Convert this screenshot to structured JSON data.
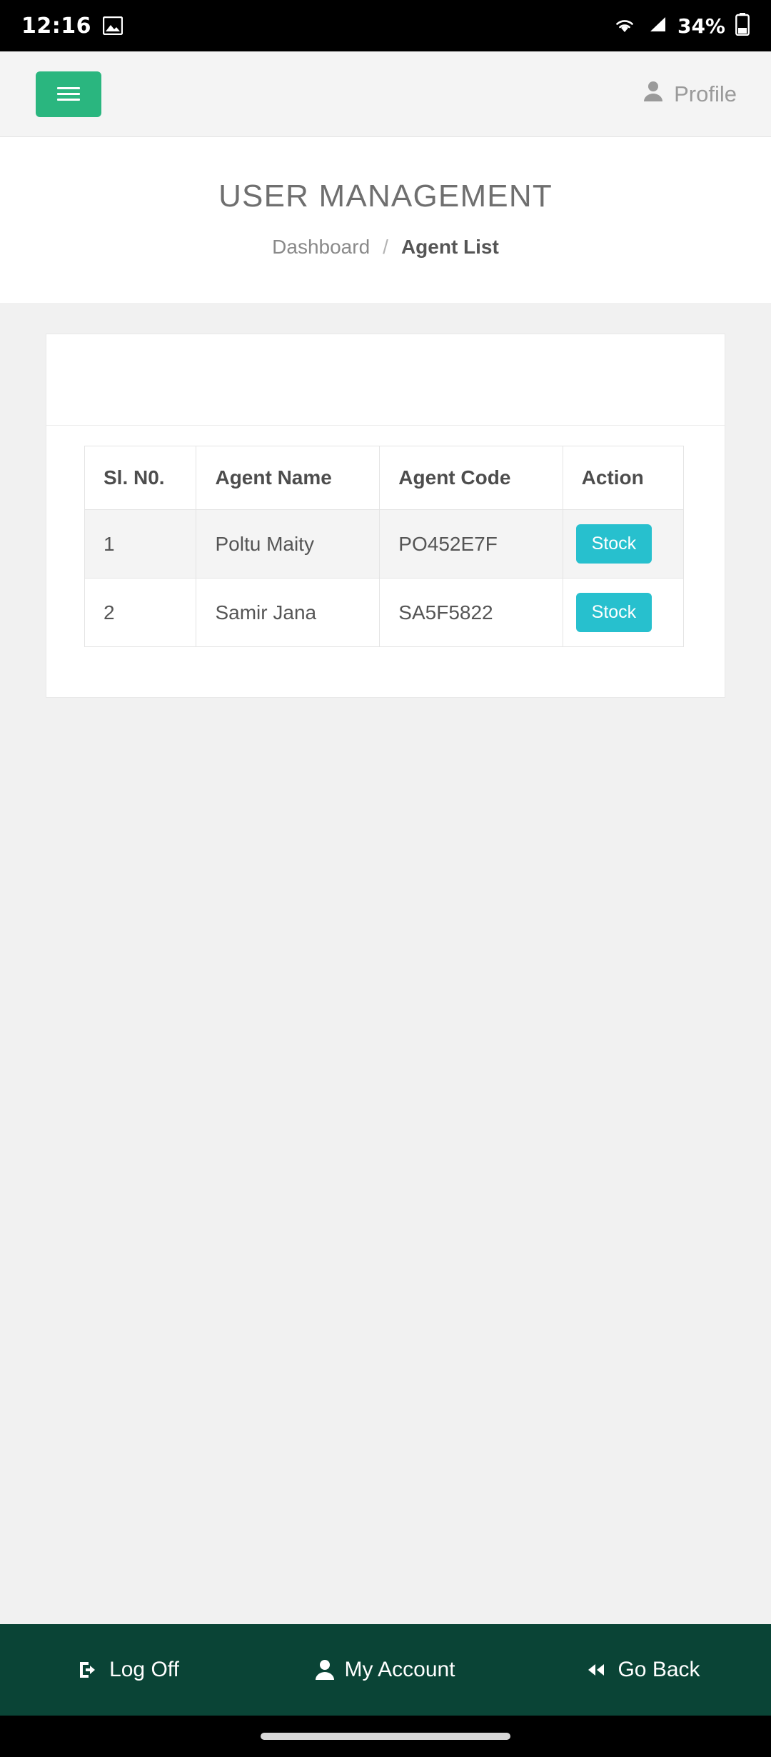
{
  "statusbar": {
    "time": "12:16",
    "image_icon": "image-icon",
    "wifi_icon": "wifi-icon",
    "signal_icon": "cellular-signal-icon",
    "battery_percent": "34%",
    "battery_icon": "battery-icon"
  },
  "appbar": {
    "menu_icon": "hamburger-menu-icon",
    "profile_label": "Profile",
    "profile_icon": "person-icon"
  },
  "header": {
    "title": "USER MANAGEMENT",
    "breadcrumb": {
      "parent": "Dashboard",
      "separator": "/",
      "current": "Agent List"
    }
  },
  "table": {
    "columns": [
      "Sl. N0.",
      "Agent Name",
      "Agent Code",
      "Action"
    ],
    "rows": [
      {
        "sl": "1",
        "name": "Poltu Maity",
        "code": "PO452E7F",
        "action": "Stock"
      },
      {
        "sl": "2",
        "name": "Samir Jana",
        "code": "SA5F5822",
        "action": "Stock"
      }
    ]
  },
  "bottombar": {
    "items": [
      {
        "label": "Log Off",
        "icon": "logout-icon"
      },
      {
        "label": "My Account",
        "icon": "person-icon"
      },
      {
        "label": "Go Back",
        "icon": "double-chevron-left-icon"
      }
    ]
  },
  "colors": {
    "accent_green": "#2ab67f",
    "stock_button": "#27c0ce",
    "bottom_bar": "#0a4436"
  }
}
